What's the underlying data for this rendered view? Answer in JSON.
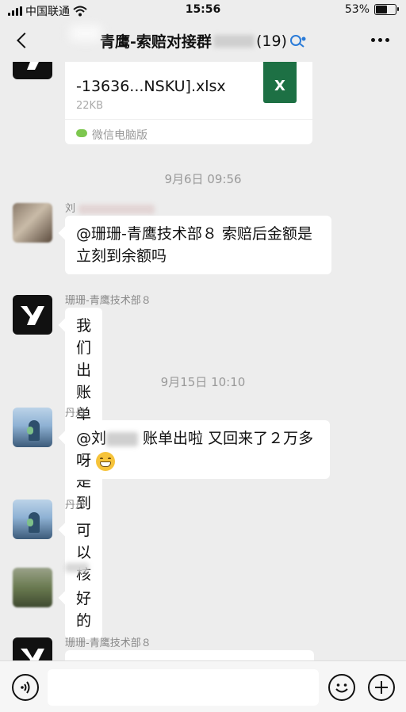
{
  "status_bar": {
    "carrier": "中国联通",
    "time": "15:56",
    "battery": "53%"
  },
  "header": {
    "title_prefix": "青鹰-索赔对接群",
    "member_count": "(19)"
  },
  "file_message": {
    "file_name": "-13636...NSKU].xlsx",
    "file_size": "22KB",
    "source": "微信电脑版",
    "file_icon_letter": "X"
  },
  "timestamps": {
    "t1": "9月6日 09:56",
    "t2": "9月15日 10:10"
  },
  "messages": [
    {
      "sender": "刘",
      "text": "@珊珊-青鹰技术部８ 索赔后金额是立刻到余额吗"
    },
    {
      "sender": "珊珊-青鹰技术部８",
      "text": "我们出账单的都是到了账的"
    },
    {
      "sender": "丹丹",
      "text_prefix": "@刘",
      "text_suffix": " 账单出啦 又回来了２万多呀",
      "emoji": "😁"
    },
    {
      "sender": "丹丹",
      "text": "可以核对拉"
    },
    {
      "sender": "",
      "text": "好的"
    },
    {
      "sender": "珊珊-青鹰技术部８",
      "text": ""
    }
  ],
  "colors": {
    "background": "#ededed",
    "bubble": "#ffffff",
    "excel_green": "#1d7044"
  },
  "icons": [
    "back-icon",
    "more-icon",
    "voice-icon",
    "emoji-icon",
    "plus-icon",
    "excel-file-icon",
    "wechat-icon",
    "member-icon"
  ]
}
